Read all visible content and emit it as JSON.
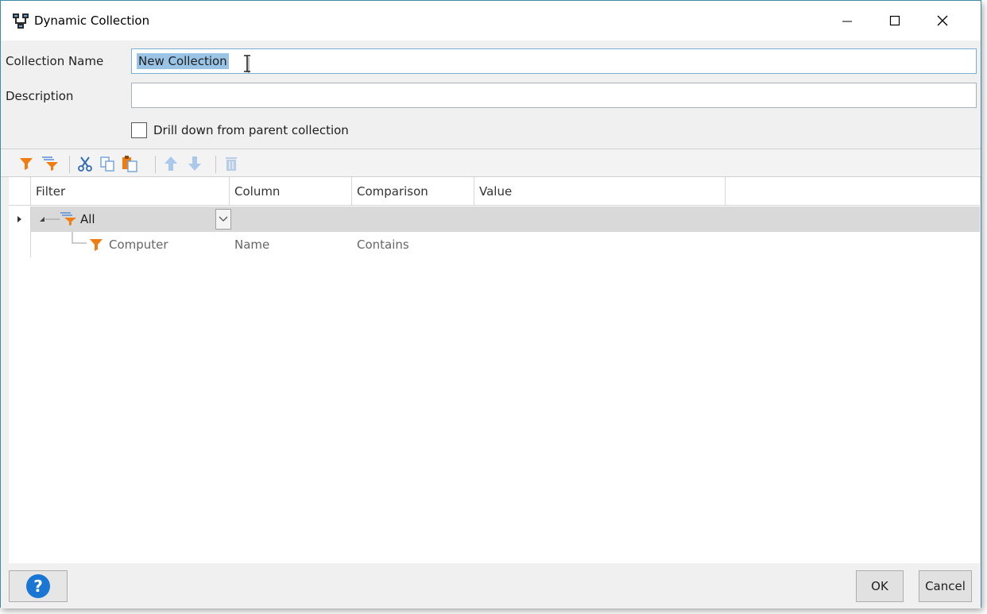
{
  "window": {
    "title": "Dynamic Collection",
    "icon": "collection-icon"
  },
  "form": {
    "collection_name_label": "Collection Name",
    "collection_name_value": "New Collection",
    "description_label": "Description",
    "description_value": "",
    "drill_down_label": "Drill down from parent collection",
    "drill_down_checked": false
  },
  "toolbar": {
    "icons": [
      "add-filter-icon",
      "add-group-icon",
      "cut-icon",
      "copy-icon",
      "paste-icon",
      "move-up-icon",
      "move-down-icon",
      "delete-icon"
    ]
  },
  "grid": {
    "columns": [
      "Filter",
      "Column",
      "Comparison",
      "Value"
    ],
    "rows": [
      {
        "filter": "All",
        "column": "",
        "comparison": "",
        "value": ""
      },
      {
        "filter": "Computer",
        "column": "Name",
        "comparison": "Contains",
        "value": ""
      }
    ]
  },
  "footer": {
    "help_label": "?",
    "ok_label": "OK",
    "cancel_label": "Cancel"
  },
  "colors": {
    "accent": "#3c8da3",
    "filter_orange": "#f07d12",
    "selection": "#9ac4e6",
    "group_row": "#d9d9d9"
  }
}
